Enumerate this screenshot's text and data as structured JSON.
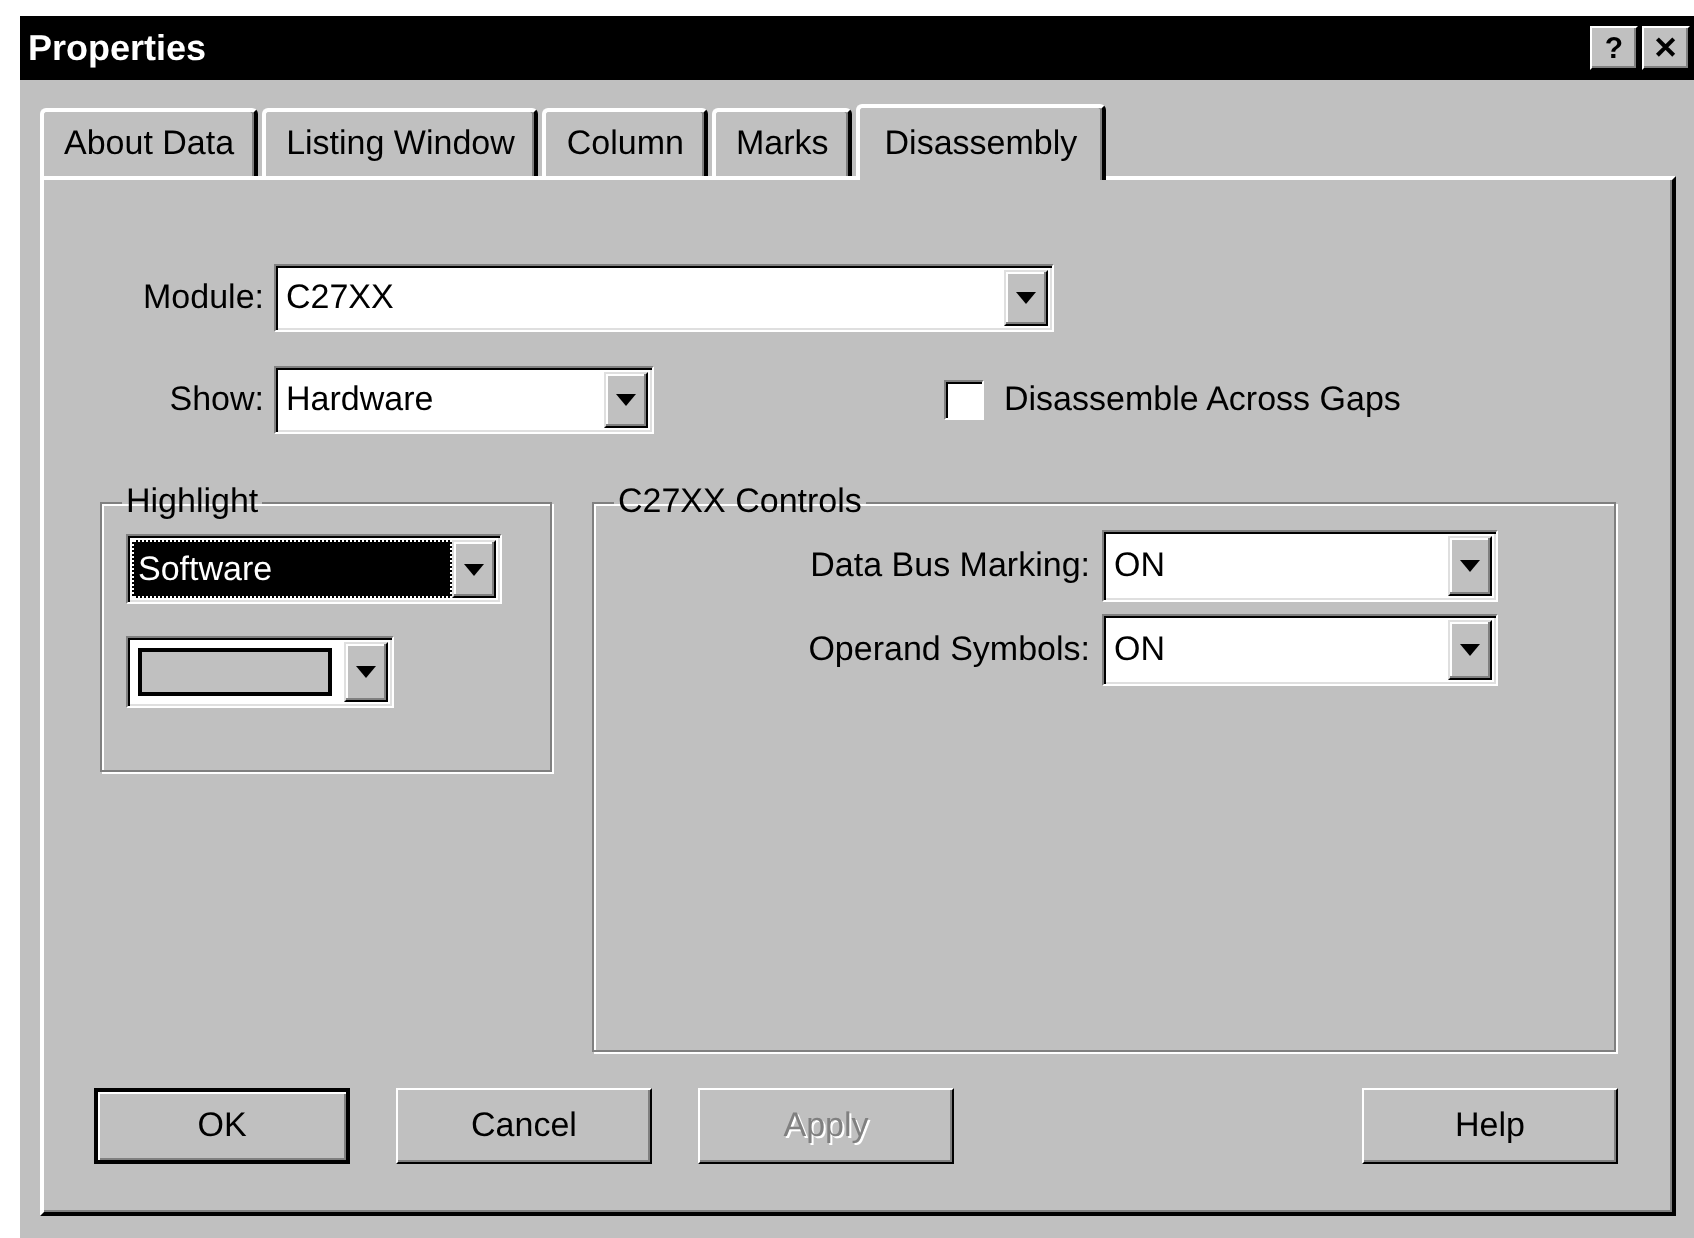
{
  "window": {
    "title": "Properties",
    "help_button": "?",
    "close_button": "✕"
  },
  "tabs": [
    {
      "label": "About Data",
      "selected": false
    },
    {
      "label": "Listing Window",
      "selected": false
    },
    {
      "label": "Column",
      "selected": false
    },
    {
      "label": "Marks",
      "selected": false
    },
    {
      "label": "Disassembly",
      "selected": true
    }
  ],
  "module": {
    "label": "Module:",
    "value": "C27XX"
  },
  "show": {
    "label": "Show:",
    "value": "Hardware"
  },
  "checkbox": {
    "label": "Disassemble Across Gaps",
    "checked": false
  },
  "highlight": {
    "title": "Highlight",
    "value": "Software",
    "focused": true
  },
  "controls": {
    "title": "C27XX Controls",
    "fields": [
      {
        "label": "Data Bus Marking:",
        "value": "ON"
      },
      {
        "label": "Operand Symbols:",
        "value": "ON"
      }
    ]
  },
  "buttons": [
    {
      "label": "OK",
      "default": true,
      "disabled": false,
      "kind": "left"
    },
    {
      "label": "Cancel",
      "default": false,
      "disabled": false,
      "kind": "left"
    },
    {
      "label": "Apply",
      "default": false,
      "disabled": true,
      "kind": "left"
    },
    {
      "label": "Help",
      "default": false,
      "disabled": false,
      "kind": "right"
    }
  ]
}
